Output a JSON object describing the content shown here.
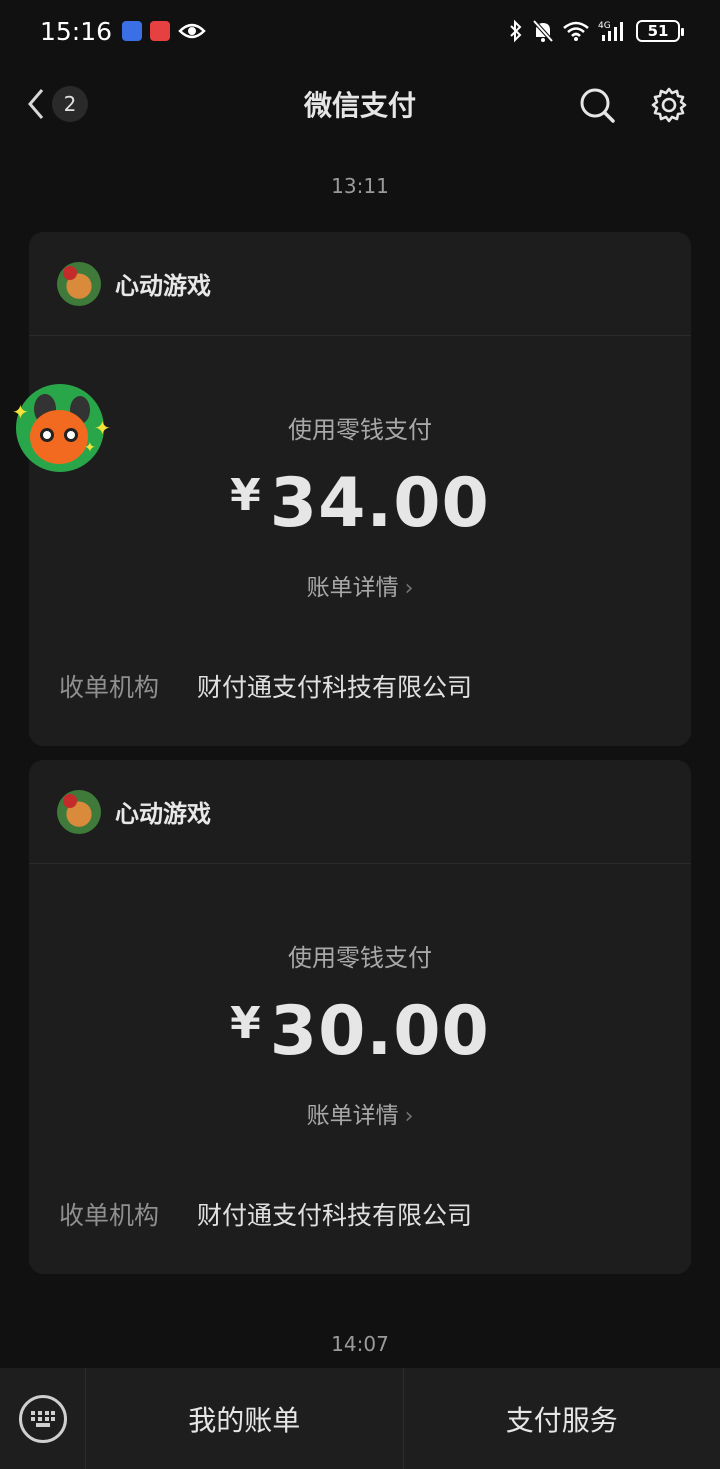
{
  "status_bar": {
    "time": "15:16",
    "battery": "51"
  },
  "nav": {
    "unread_count": "2",
    "title": "微信支付"
  },
  "messages": [
    {
      "time": "13:11",
      "merchant": "心动游戏",
      "pay_method": "使用零钱支付",
      "currency": "¥",
      "amount": "34.00",
      "detail_link": "账单详情",
      "acquirer_label": "收单机构",
      "acquirer_value": "财付通支付科技有限公司"
    },
    {
      "merchant": "心动游戏",
      "pay_method": "使用零钱支付",
      "currency": "¥",
      "amount": "30.00",
      "detail_link": "账单详情",
      "acquirer_label": "收单机构",
      "acquirer_value": "财付通支付科技有限公司"
    }
  ],
  "second_time": "14:07",
  "bottom_menu": {
    "bills": "我的账单",
    "services": "支付服务"
  },
  "colors": {
    "background": "#111111",
    "card": "#1d1d1d",
    "bottom_bar": "#1e1e1e"
  }
}
